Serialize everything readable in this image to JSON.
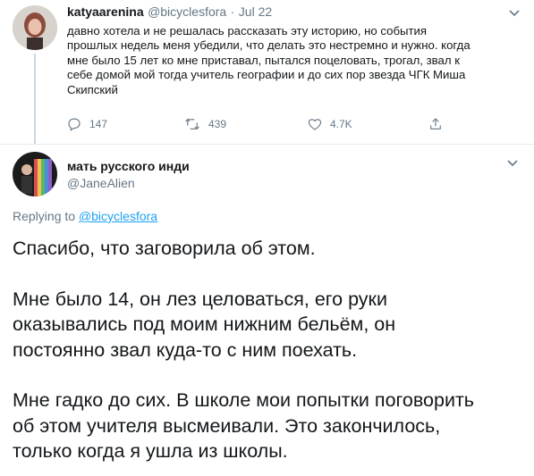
{
  "original_tweet": {
    "author_name": "katyaarenina",
    "author_handle": "@bicyclesfora",
    "separator": "·",
    "date": "Jul 22",
    "text_lines": [
      "давно хотела и не решалась рассказать эту историю, но события",
      "прошлых недель меня убедили, что делать это нестремно и нужно. когда",
      "мне было 15 лет ко мне приставал, пытался поцеловать, трогал, звал к",
      "себе домой мой тогда учитель географии и до сих пор звезда ЧГК Миша",
      "Скипский"
    ],
    "replies": "147",
    "retweets": "439",
    "likes": "4.7K"
  },
  "reply_tweet": {
    "author_name": "мать русского инди",
    "author_handle": "@JaneAlien",
    "replying_to_label": "Replying to",
    "replying_to_handle": "@bicyclesfora",
    "paragraphs": [
      [
        "Спасибо, что заговорила об этом."
      ],
      [
        "Мне было 14, он лез целоваться, его руки",
        "оказывались под моим нижним бельём, он",
        "постоянно звал куда-то с ним поехать."
      ],
      [
        "Мне гадко до сих. В школе мои попытки поговорить",
        "об этом учителя высмеивали. Это закончилось,",
        "только когда я ушла из школы."
      ]
    ]
  },
  "icons": [
    "chevron-down-icon",
    "reply-icon",
    "retweet-icon",
    "like-icon",
    "share-icon"
  ],
  "colors": {
    "text": "#14171a",
    "muted": "#657786",
    "link": "#1da1f2",
    "divider": "#e6ecf0",
    "thread_line": "#ccd6dd"
  }
}
